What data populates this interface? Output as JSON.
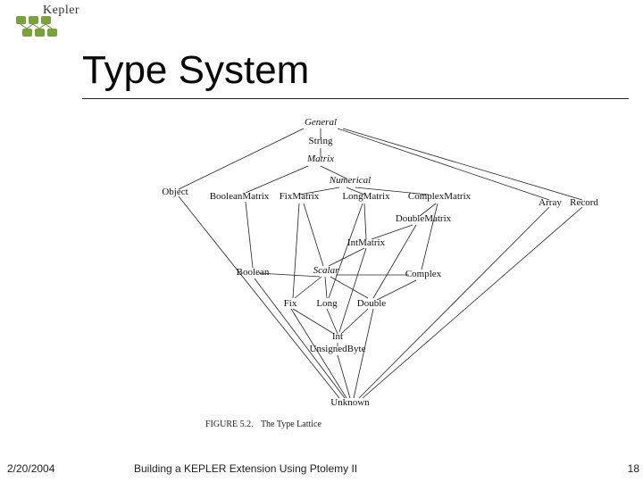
{
  "logo": {
    "name": "Kepler"
  },
  "title": "Type System",
  "footer": {
    "date": "2/20/2004",
    "center": "Building a KEPLER Extension Using Ptolemy II",
    "page": "18"
  },
  "diagram": {
    "caption_prefix": "FIGURE 5.2.",
    "caption_text": "The Type Lattice",
    "nodes": {
      "general": {
        "label": "General",
        "italic": true
      },
      "string": {
        "label": "String",
        "italic": false
      },
      "matrix": {
        "label": "Matrix",
        "italic": true
      },
      "numerical": {
        "label": "Numerical",
        "italic": true
      },
      "object": {
        "label": "Object",
        "italic": false
      },
      "booleanmatrix": {
        "label": "BooleanMatrix",
        "italic": false
      },
      "fixmatrix": {
        "label": "FixMatrix",
        "italic": false
      },
      "longmatrix": {
        "label": "LongMatrix",
        "italic": false
      },
      "complexmatrix": {
        "label": "ComplexMatrix",
        "italic": false
      },
      "doublematrix": {
        "label": "DoubleMatrix",
        "italic": false
      },
      "array": {
        "label": "Array",
        "italic": false
      },
      "record": {
        "label": "Record",
        "italic": false
      },
      "intmatrix": {
        "label": "IntMatrix",
        "italic": false
      },
      "boolean": {
        "label": "Boolean",
        "italic": false
      },
      "scalar": {
        "label": "Scalar",
        "italic": true
      },
      "complex": {
        "label": "Complex",
        "italic": false
      },
      "fix": {
        "label": "Fix",
        "italic": false
      },
      "long": {
        "label": "Long",
        "italic": false
      },
      "double": {
        "label": "Double",
        "italic": false
      },
      "int": {
        "label": "Int",
        "italic": false
      },
      "unsignedbyte": {
        "label": "UnsignedByte",
        "italic": false
      },
      "unknown": {
        "label": "Unknown",
        "italic": false
      }
    }
  }
}
